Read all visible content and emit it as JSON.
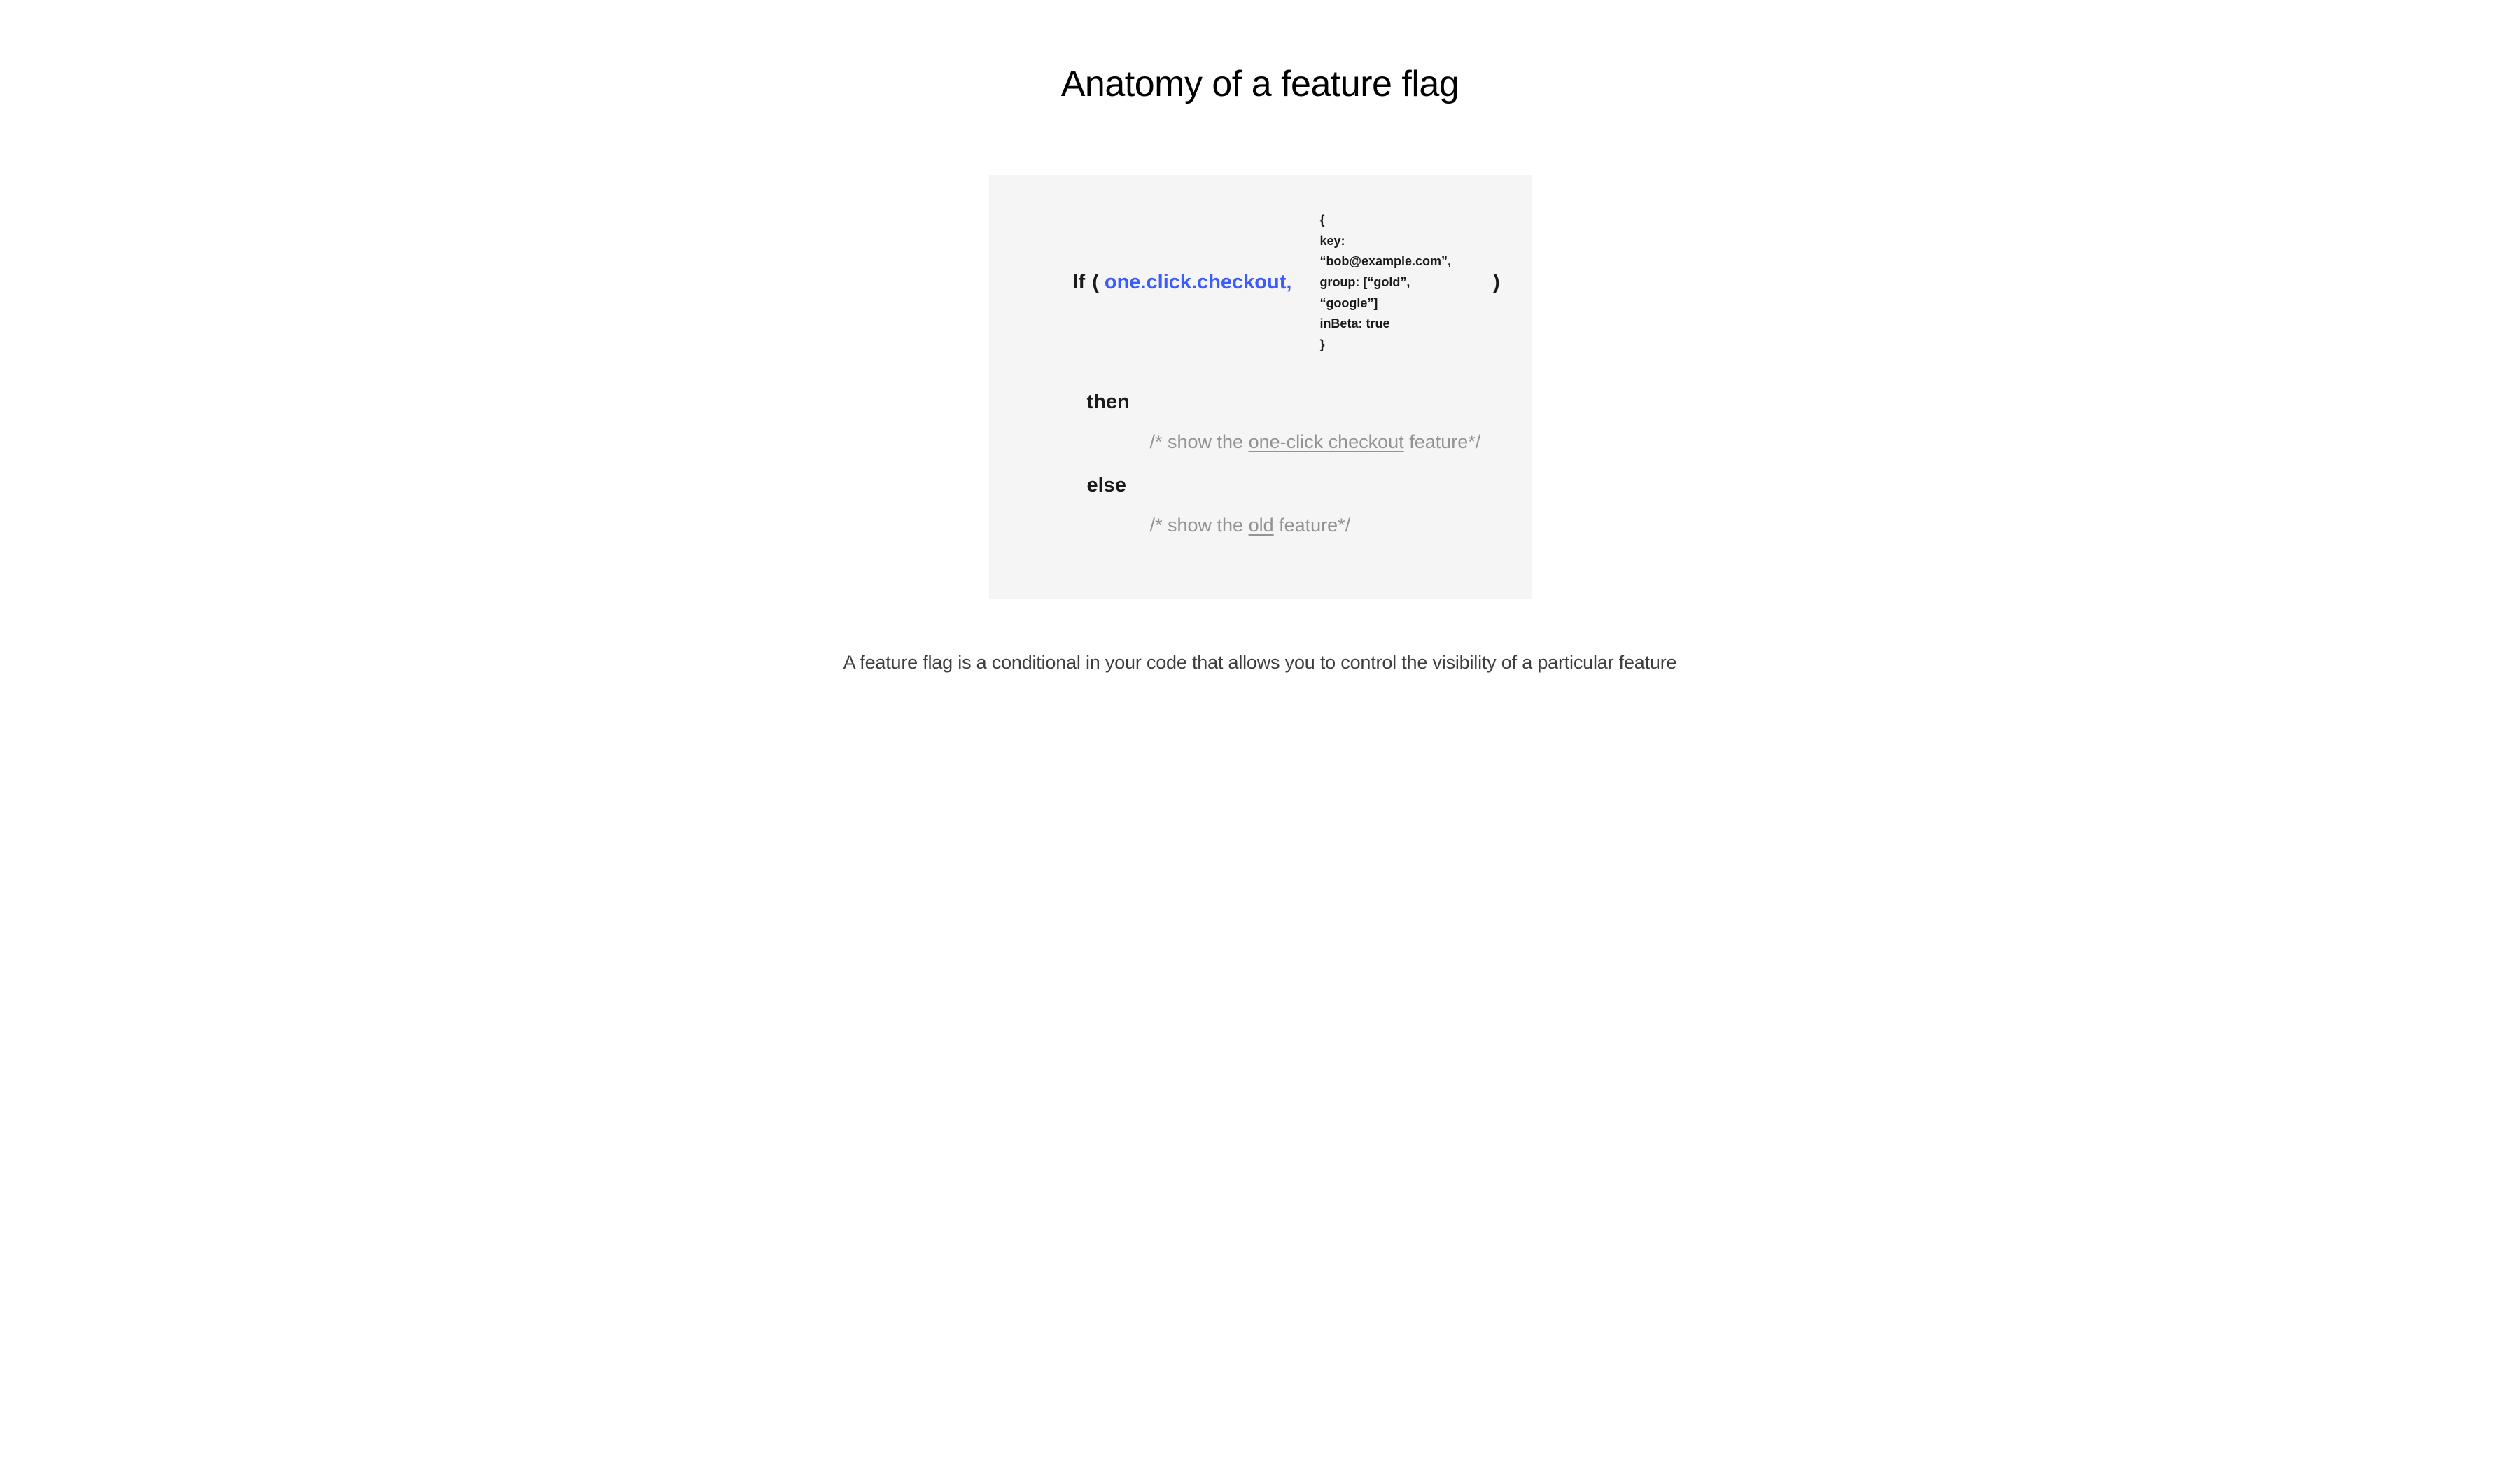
{
  "title": "Anatomy of a feature flag",
  "code": {
    "if": "If",
    "open_paren": "(",
    "flag_name": "one.click.checkout,",
    "context": {
      "open": "{",
      "key": "key: “bob@example.com”,",
      "group": "group: [“gold”, “google”]",
      "inBeta": "inBeta: true",
      "close": "}"
    },
    "close_paren": ")",
    "then": "then",
    "then_comment_prefix": "/* show the ",
    "then_comment_underline": "one-click checkout",
    "then_comment_suffix": " feature*/",
    "else": "else",
    "else_comment_prefix": "/* show the ",
    "else_comment_underline": "old",
    "else_comment_suffix": " feature*/"
  },
  "footer": "A feature flag is a conditional in your code that allows you to control the visibility of a particular feature"
}
